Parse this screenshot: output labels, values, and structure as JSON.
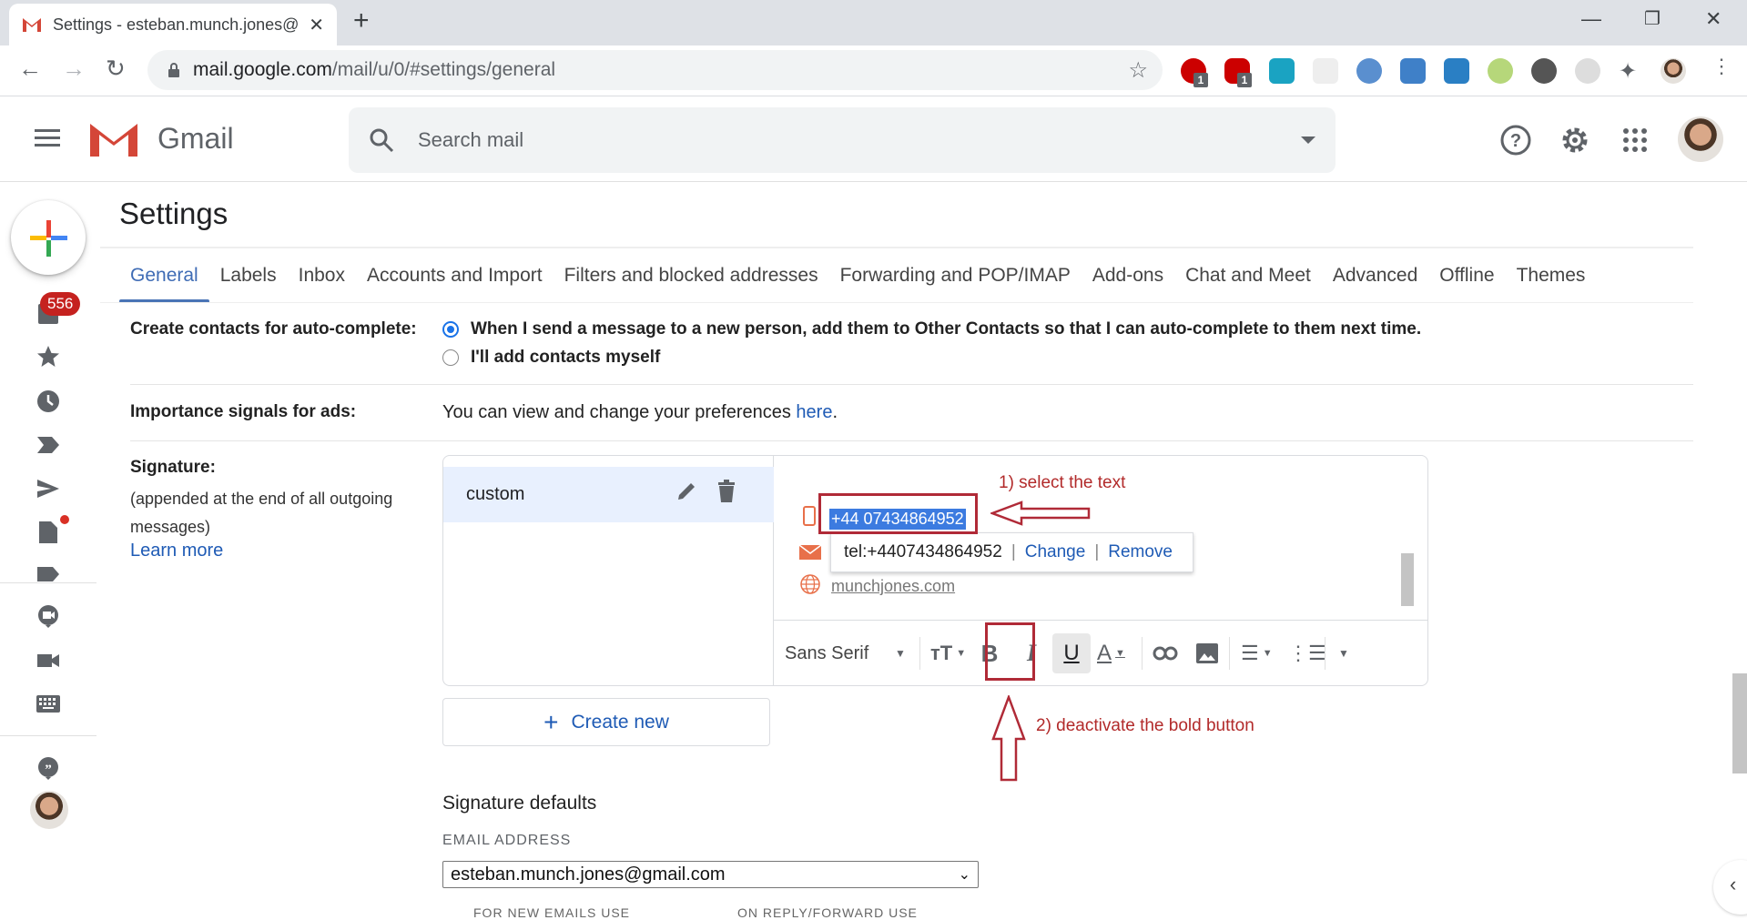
{
  "browser": {
    "tab_title": "Settings - esteban.munch.jones@",
    "url_host": "mail.google.com",
    "url_path": "/mail/u/0/#settings/general",
    "extension_badges": [
      "1",
      "1"
    ]
  },
  "header": {
    "app_name": "Gmail",
    "search_placeholder": "Search mail"
  },
  "rail": {
    "inbox_badge": "556"
  },
  "settings": {
    "title": "Settings",
    "tabs": [
      {
        "label": "General",
        "active": true
      },
      {
        "label": "Labels"
      },
      {
        "label": "Inbox"
      },
      {
        "label": "Accounts and Import"
      },
      {
        "label": "Filters and blocked addresses"
      },
      {
        "label": "Forwarding and POP/IMAP"
      },
      {
        "label": "Add-ons"
      },
      {
        "label": "Chat and Meet"
      },
      {
        "label": "Advanced"
      },
      {
        "label": "Offline"
      },
      {
        "label": "Themes"
      }
    ],
    "auto_complete": {
      "label": "Create contacts for auto-complete:",
      "option1": "When I send a message to a new person, add them to Other Contacts so that I can auto-complete to them next time.",
      "option2": "I'll add contacts myself",
      "selected": "option1"
    },
    "ads": {
      "label": "Importance signals for ads:",
      "text": "You can view and change your preferences ",
      "link": "here",
      "suffix": "."
    },
    "signature": {
      "label": "Signature:",
      "desc": "(appended at the end of all outgoing messages)",
      "learn_more": "Learn more",
      "items": [
        {
          "name": "custom"
        }
      ],
      "phone": "+44 07434864952",
      "website": "munchjones.com",
      "tooltip": {
        "link": "tel:+4407434864952",
        "change": "Change",
        "remove": "Remove",
        "sep": "|"
      },
      "toolbar": {
        "font": "Sans Serif",
        "bold": "B",
        "italic": "I",
        "underline": "U",
        "text_color": "A"
      },
      "create_new": "Create new",
      "defaults_title": "Signature defaults",
      "email_label": "EMAIL ADDRESS",
      "email_value": "esteban.munch.jones@gmail.com",
      "new_emails_label": "FOR NEW EMAILS USE",
      "reply_label": "ON REPLY/FORWARD USE"
    }
  },
  "annotations": {
    "step1": "1) select the text",
    "step2": "2) deactivate the bold button",
    "color": "#b22a2a"
  }
}
